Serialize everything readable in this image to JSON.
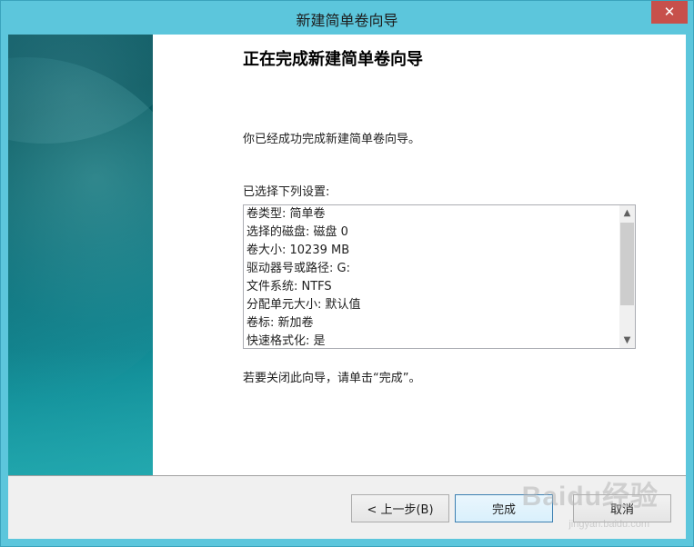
{
  "window": {
    "title": "新建简单卷向导",
    "close_glyph": "✕"
  },
  "content": {
    "heading": "正在完成新建简单卷向导",
    "intro": "你已经成功完成新建简单卷向导。",
    "settings_label": "已选择下列设置:",
    "settings": [
      "卷类型: 简单卷",
      "选择的磁盘: 磁盘 0",
      "卷大小: 10239 MB",
      "驱动器号或路径: G:",
      "文件系统: NTFS",
      "分配单元大小: 默认值",
      "卷标: 新加卷",
      "快速格式化: 是"
    ],
    "closing": "若要关闭此向导，请单击“完成”。"
  },
  "scrollbar": {
    "up_icon": "chevron-up-icon",
    "down_icon": "chevron-down-icon"
  },
  "buttons": {
    "back_label": "< 上一步(B)",
    "finish_label": "完成",
    "cancel_label": "取消"
  },
  "watermark": {
    "brand": "Baidu经验",
    "url": "jingyan.baidu.com"
  },
  "colors": {
    "window_frame": "#5cc6dc",
    "close_button": "#c7504b",
    "banner": "#0b6f79"
  }
}
